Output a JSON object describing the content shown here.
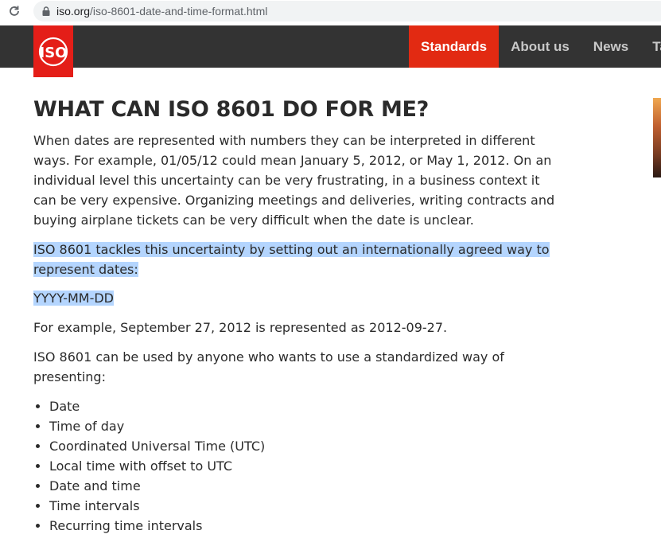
{
  "browser": {
    "url_host": "iso.org",
    "url_path": "/iso-8601-date-and-time-format.html"
  },
  "header": {
    "logo_text": "ISO",
    "nav": [
      {
        "label": "Standards",
        "active": true
      },
      {
        "label": "About us",
        "active": false
      },
      {
        "label": "News",
        "active": false
      },
      {
        "label": "Tal",
        "active": false
      }
    ]
  },
  "article": {
    "title": "WHAT CAN ISO 8601 DO FOR ME?",
    "para1": "When dates are represented with numbers they can be interpreted in different ways. For example, 01/05/12 could mean January 5, 2012, or May 1, 2012. On an individual level this uncertainty can be very frustrating, in a business context it can be very expensive. Organizing meetings and deliveries, writing contracts and buying airplane tickets can be very difficult when the date is unclear.",
    "para2_line1": "ISO 8601 tackles this uncertainty by setting out an internationally agreed way to",
    "para2_line2": "represent dates:",
    "format": "YYYY-MM-DD",
    "para4": "For example, September 27, 2012 is represented as 2012-09-27.",
    "para5": "ISO 8601 can be used by anyone who wants to use a standardized way of presenting:",
    "list": [
      "Date",
      "Time of day",
      "Coordinated Universal Time (UTC)",
      "Local time with offset to UTC",
      "Date and time",
      "Time intervals",
      "Recurring time intervals"
    ]
  },
  "colors": {
    "header_bg": "#333333",
    "accent_red": "#e22a12",
    "selection": "#b4d5fe"
  }
}
